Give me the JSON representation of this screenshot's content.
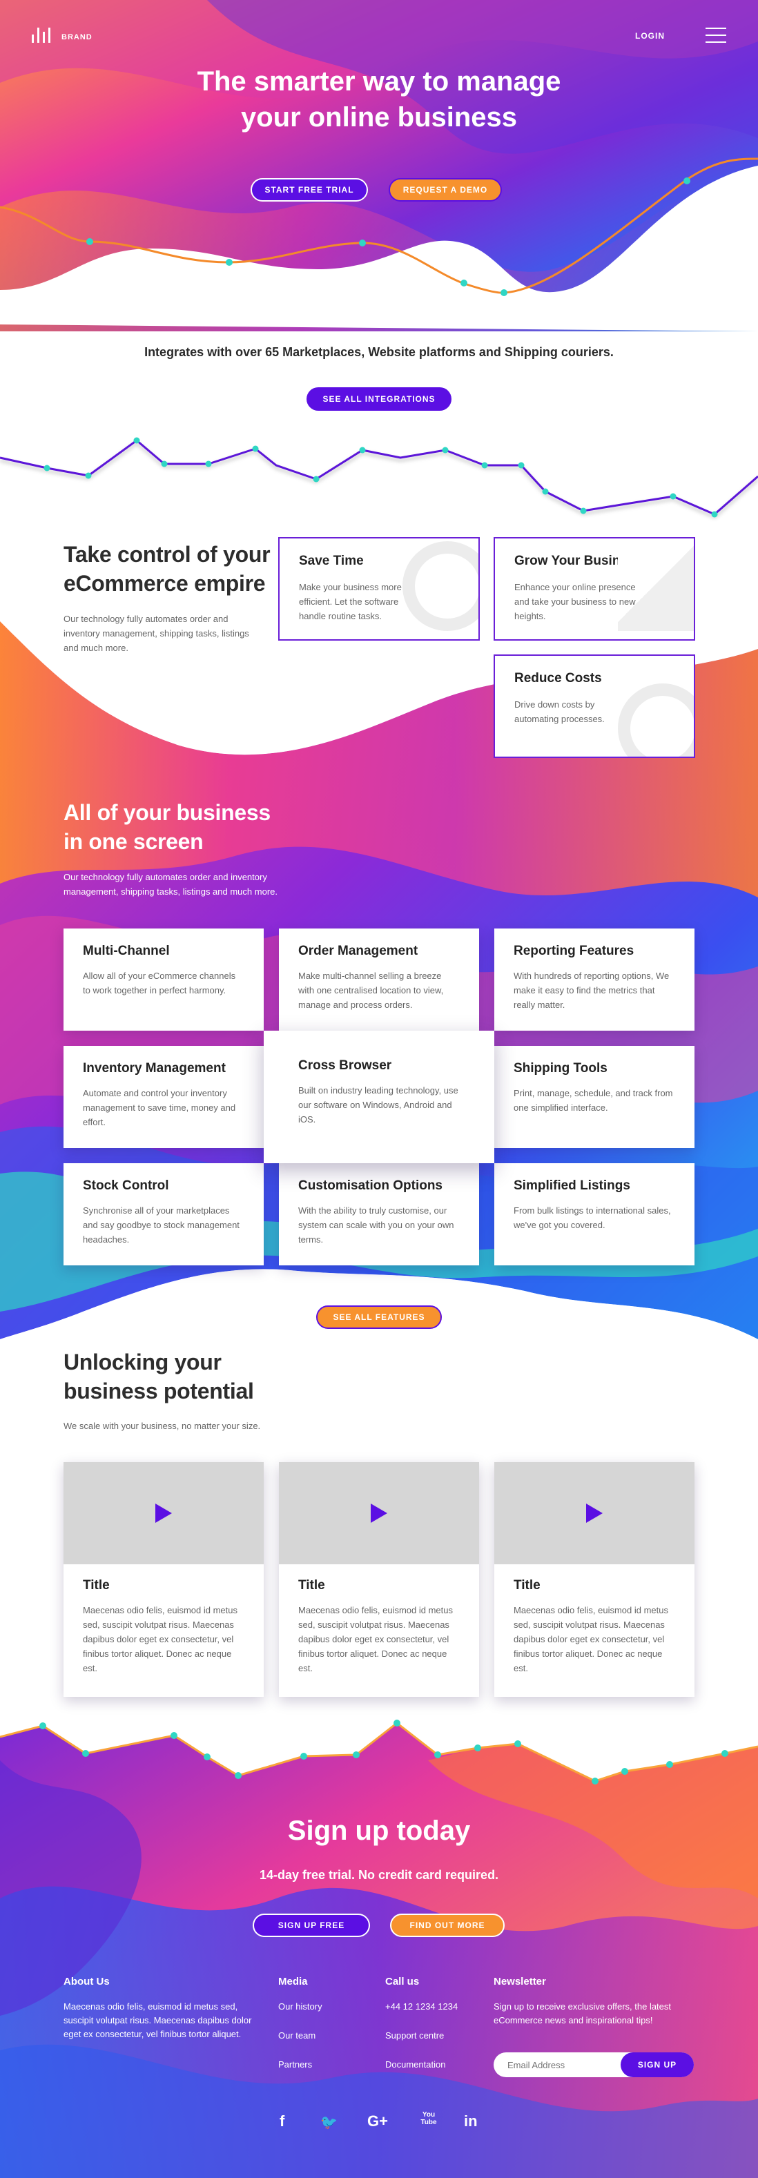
{
  "header": {
    "brand": "BRAND",
    "login": "LOGIN"
  },
  "hero": {
    "title_line1": "The smarter way to manage",
    "title_line2": "your online business",
    "cta_primary": "START FREE TRIAL",
    "cta_secondary": "REQUEST A DEMO"
  },
  "integrations": {
    "text": "Integrates with over 65 Marketplaces, Website platforms and Shipping couriers.",
    "button": "SEE ALL INTEGRATIONS"
  },
  "control": {
    "title_line1": "Take control of your",
    "title_line2": "eCommerce empire",
    "body": "Our technology fully automates order and inventory management, shipping tasks, listings and much more.",
    "cards": [
      {
        "title": "Save Time",
        "body": "Make your business more efficient. Let the software handle routine tasks."
      },
      {
        "title": "Grow Your Business",
        "body": "Enhance your online presence and take your business to new heights."
      },
      {
        "title": "Reduce Costs",
        "body": "Drive down costs by automating processes."
      }
    ]
  },
  "features": {
    "title_line1": "All of your business",
    "title_line2": "in one screen",
    "body": "Our technology fully automates order and inventory management, shipping tasks, listings and much more.",
    "items": [
      {
        "title": "Multi-Channel",
        "body": "Allow all of your eCommerce channels to work together in perfect harmony."
      },
      {
        "title": "Order Management",
        "body": "Make multi-channel selling a breeze with one centralised location to view, manage and process orders."
      },
      {
        "title": "Reporting Features",
        "body": "With hundreds of reporting options, We make it easy to find the metrics that really matter."
      },
      {
        "title": "Inventory Management",
        "body": "Automate and control your inventory management to save time, money and effort."
      },
      {
        "title": "Cross Browser",
        "body": "Built on industry leading technology, use our software on Windows, Android and iOS."
      },
      {
        "title": "Shipping Tools",
        "body": "Print, manage, schedule, and track from one simplified interface."
      },
      {
        "title": "Stock Control",
        "body": "Synchronise all of your marketplaces and say goodbye to stock management headaches."
      },
      {
        "title": "Customisation Options",
        "body": "With the ability to truly customise, our system can scale with you on your own terms."
      },
      {
        "title": "Simplified Listings",
        "body": "From bulk listings to international sales, we've got you covered."
      }
    ],
    "button": "SEE ALL FEATURES"
  },
  "potential": {
    "title_line1": "Unlocking your",
    "title_line2": "business potential",
    "subtitle": "We scale with your business, no matter your size.",
    "videos": [
      {
        "title": "Title",
        "body": "Maecenas odio felis, euismod id metus sed, suscipit volutpat risus. Maecenas dapibus dolor eget ex consectetur, vel finibus tortor aliquet. Donec ac neque est."
      },
      {
        "title": "Title",
        "body": "Maecenas odio felis, euismod id metus sed, suscipit volutpat risus. Maecenas dapibus dolor eget ex consectetur, vel finibus tortor aliquet. Donec ac neque est."
      },
      {
        "title": "Title",
        "body": "Maecenas odio felis, euismod id metus sed, suscipit volutpat risus. Maecenas dapibus dolor eget ex consectetur, vel finibus tortor aliquet. Donec ac neque est."
      }
    ]
  },
  "signup": {
    "title": "Sign up today",
    "subtitle": "14-day free trial. No credit card required.",
    "cta_primary": "SIGN UP FREE",
    "cta_secondary": "FIND OUT MORE"
  },
  "footer": {
    "about_heading": "About Us",
    "about_body": "Maecenas odio felis, euismod id metus sed, suscipit volutpat risus. Maecenas dapibus dolor eget ex consectetur, vel finibus tortor aliquet.",
    "media_heading": "Media",
    "media_links": [
      "Our history",
      "Our team",
      "Partners"
    ],
    "call_heading": "Call us",
    "call_links": [
      "+44 12 1234 1234",
      "Support centre",
      "Documentation"
    ],
    "newsletter_heading": "Newsletter",
    "newsletter_body": "Sign up to receive exclusive offers, the latest eCommerce news and inspirational tips!",
    "email_placeholder": "Email Address",
    "signup_button": "SIGN UP",
    "social": [
      "f",
      "🐦",
      "G+",
      "You Tube",
      "in"
    ]
  },
  "colors": {
    "purple": "#5b0fe3",
    "orange": "#f7922e",
    "pink": "#e8359a",
    "blue": "#2b5cf0",
    "teal": "#2fd6c4"
  }
}
